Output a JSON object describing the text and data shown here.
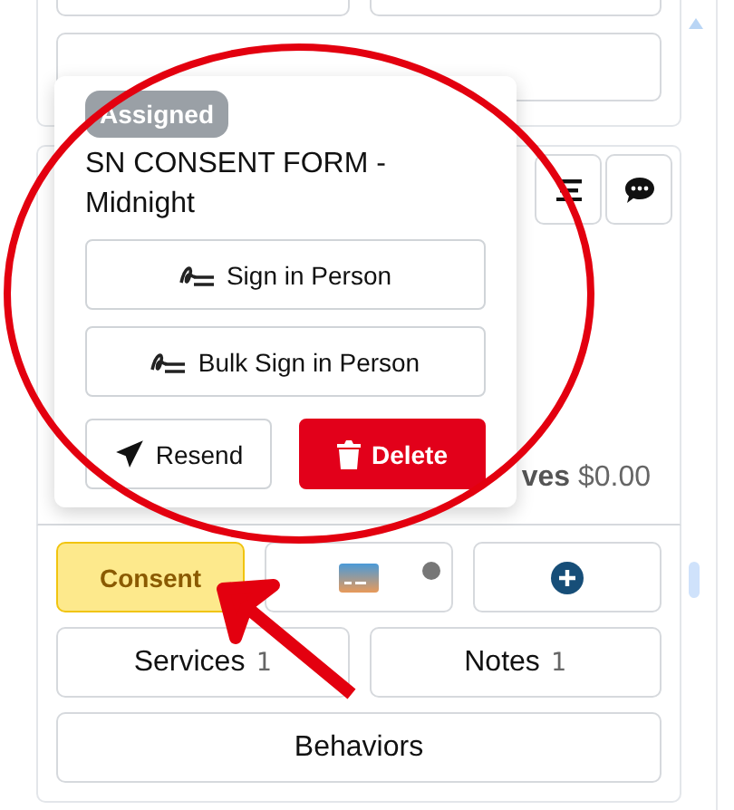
{
  "toolbar": {
    "buttons": [
      {
        "kind": "menu"
      },
      {
        "kind": "chat"
      }
    ]
  },
  "summary": {
    "text": "**ves** $0.00"
  },
  "popover": {
    "badge": "Assigned",
    "title": "SN CONSENT FORM - Midnight",
    "actions": [
      {
        "label": "Sign in Person",
        "kind": "sign"
      },
      {
        "label": "Bulk Sign in Person",
        "kind": "sign"
      },
      {
        "label": "Resend",
        "kind": "send"
      },
      {
        "label": "Delete",
        "kind": "delete"
      }
    ]
  },
  "tab_rows": [
    [
      {
        "kind": "text",
        "label": "Consent",
        "selected": true
      },
      {
        "kind": "card",
        "selected": false,
        "indicator": true
      },
      {
        "kind": "add",
        "selected": false
      }
    ],
    [
      {
        "kind": "text",
        "label": "Services",
        "count": "1",
        "selected": false
      },
      {
        "kind": "text",
        "label": "Notes",
        "count": "1",
        "selected": false
      }
    ],
    [
      {
        "kind": "text",
        "label": "Behaviors",
        "selected": false
      }
    ]
  ]
}
